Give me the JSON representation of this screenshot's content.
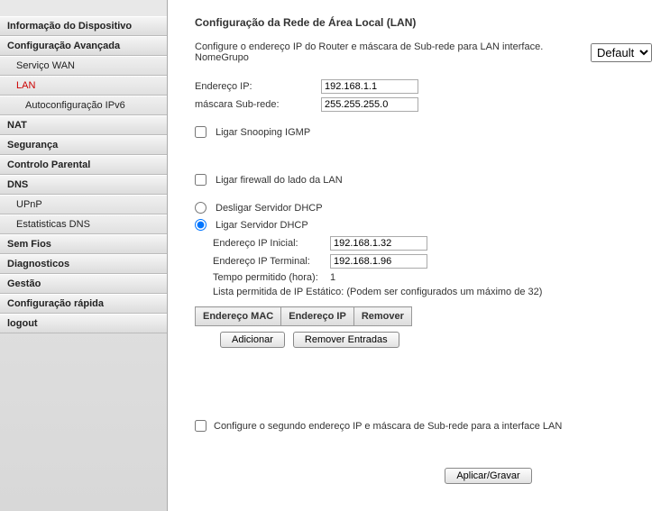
{
  "sidebar": {
    "items": [
      {
        "label": "Informação do Dispositivo",
        "level": 0
      },
      {
        "label": "Configuração Avançada",
        "level": 0
      },
      {
        "label": "Serviço WAN",
        "level": 1
      },
      {
        "label": "LAN",
        "level": 1,
        "active": true
      },
      {
        "label": "Autoconfiguração IPv6",
        "level": 2
      },
      {
        "label": "NAT",
        "level": 0
      },
      {
        "label": "Segurança",
        "level": 0
      },
      {
        "label": "Controlo Parental",
        "level": 0
      },
      {
        "label": "DNS",
        "level": 0
      },
      {
        "label": "UPnP",
        "level": 1
      },
      {
        "label": "Estatisticas DNS",
        "level": 1
      },
      {
        "label": "Sem Fios",
        "level": 0
      },
      {
        "label": "Diagnosticos",
        "level": 0
      },
      {
        "label": "Gestão",
        "level": 0
      },
      {
        "label": "Configuração rápida",
        "level": 0
      },
      {
        "label": "logout",
        "level": 0
      }
    ]
  },
  "page": {
    "title": "Configuração da Rede de Área Local (LAN)",
    "intro": "Configure o endereço IP do Router e máscara de Sub-rede para LAN interface.  NomeGrupo",
    "group_selected": "Default",
    "ip_label": "Endereço IP:",
    "ip_value": "192.168.1.1",
    "mask_label": "máscara Sub-rede:",
    "mask_value": "255.255.255.0",
    "igmp_label": "Ligar Snooping IGMP",
    "firewall_label": "Ligar firewall do lado da LAN",
    "dhcp_off_label": "Desligar Servidor DHCP",
    "dhcp_on_label": "Ligar Servidor DHCP",
    "dhcp_start_label": "Endereço IP Inicial:",
    "dhcp_start_value": "192.168.1.32",
    "dhcp_end_label": "Endereço IP Terminal:",
    "dhcp_end_value": "192.168.1.96",
    "lease_label": "Tempo permitido (hora):",
    "lease_value": "1",
    "static_note": "Lista permitida de IP Estático: (Podem ser configurados um máximo de 32)",
    "table": {
      "col_mac": "Endereço MAC",
      "col_ip": "Endereço IP",
      "col_remove": "Remover"
    },
    "btn_add": "Adicionar",
    "btn_remove": "Remover Entradas",
    "second_ip_label": "Configure o segundo endereço IP e máscara de Sub-rede para a interface LAN",
    "apply_label": "Aplicar/Gravar"
  }
}
